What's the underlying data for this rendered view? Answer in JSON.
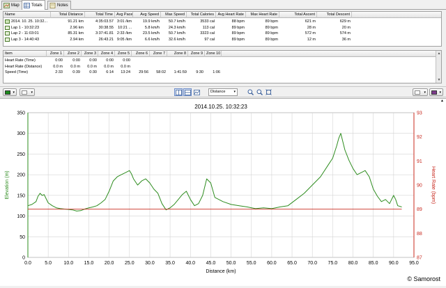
{
  "tabs": [
    {
      "label": "Map",
      "icon": "map-icon"
    },
    {
      "label": "Totals",
      "icon": "table-icon"
    },
    {
      "label": "Notes",
      "icon": "notes-icon"
    }
  ],
  "totals": {
    "headers": [
      "Name",
      "Total Distance",
      "Total Time",
      "Avg Pace",
      "Avg Speed",
      "Max Speed",
      "Total Calories",
      "Avg Heart Rate",
      "Max Heart Rate",
      "Total Ascent",
      "Total Descent"
    ],
    "rows": [
      [
        "2014. 10. 25. 10:32...",
        "91.21 km",
        "4:35:03.57",
        "3:01 /km",
        "19.9 km/h",
        "50.7 km/h",
        "3533 cal",
        "88 bpm",
        "89 bpm",
        "621 m",
        "629 m"
      ],
      [
        "Lap 1 - 10:32:23",
        "2.96 km",
        "30:38.55",
        "10:21 ...",
        "5.8 km/h",
        "24.3 km/h",
        "113 cal",
        "89 bpm",
        "89 bpm",
        "28 m",
        "20 m"
      ],
      [
        "Lap 2 - 11:03:01",
        "85.31 km",
        "3:37:41.81",
        "2:33 /km",
        "23.5 km/h",
        "50.7 km/h",
        "3323 cal",
        "89 bpm",
        "89 bpm",
        "572 m",
        "574 m"
      ],
      [
        "Lap 3 - 14:40:43",
        "2.94 km",
        "26:43.21",
        "9:05 /km",
        "6.6 km/h",
        "32.6 km/h",
        "97 cal",
        "89 bpm",
        "89 bpm",
        "12 m",
        "36 m"
      ]
    ]
  },
  "zones": {
    "headers": [
      "Item",
      "Zone 1",
      "Zone 2",
      "Zone 3",
      "Zone 4",
      "Zone 5",
      "Zone 6",
      "Zone 7",
      "Zone 8",
      "Zone 9",
      "Zone 10"
    ],
    "rows": [
      [
        "Heart Rate (Time)",
        "0:00",
        "0:00",
        "0:00",
        "0:00",
        "0:00",
        "",
        "",
        "",
        "",
        ""
      ],
      [
        "Heart Rate (Distance)",
        "0.0 m",
        "0.0 m",
        "0.0 m",
        "0.0 m",
        "0.0 m",
        "",
        "",
        "",
        "",
        ""
      ],
      [
        "Speed (Time)",
        "2:33",
        "0:39",
        "0:30",
        "6:14",
        "13:24",
        "29:56",
        "58:02",
        "1:41:59",
        "9:30",
        "1:06"
      ]
    ]
  },
  "toolbar": {
    "distance_combo": "Distance",
    "colors": {
      "left": "#1e8c1e",
      "right": "#7d3c8c",
      "elevation": "#2d8c1e",
      "heart": "#c8281e"
    }
  },
  "chart_data": {
    "type": "line",
    "title": "2014.10.25. 10:32:23",
    "xlabel": "Distance (km)",
    "ylabel": "Elevation (m)",
    "y2label": "Heart Rate (bpm)",
    "xlim": [
      0,
      95
    ],
    "ylim": [
      0,
      350
    ],
    "y2lim": [
      87,
      93
    ],
    "xticks": [
      "0.0",
      "5.0",
      "10.0",
      "15.0",
      "20.0",
      "25.0",
      "30.0",
      "35.0",
      "40.0",
      "45.0",
      "50.0",
      "55.0",
      "60.0",
      "65.0",
      "70.0",
      "75.0",
      "80.0",
      "85.0",
      "90.0",
      "95.0"
    ],
    "yticks": [
      "0",
      "50",
      "100",
      "150",
      "200",
      "250",
      "300",
      "350"
    ],
    "y2ticks": [
      "87",
      "88",
      "89",
      "90",
      "91",
      "92",
      "93"
    ],
    "grid": true,
    "series": [
      {
        "name": "Elevation",
        "axis": "left",
        "x": [
          0.0,
          1.0,
          2.0,
          2.5,
          3.0,
          3.5,
          4.0,
          4.5,
          5.0,
          6.0,
          7.0,
          8.0,
          9.0,
          10.0,
          11.0,
          12.0,
          13.0,
          14.0,
          15.0,
          16.0,
          17.0,
          18.0,
          19.0,
          20.0,
          21.0,
          22.0,
          23.0,
          24.0,
          25.0,
          25.5,
          26.0,
          27.0,
          28.0,
          29.0,
          30.0,
          31.0,
          32.0,
          33.0,
          34.0,
          35.0,
          36.0,
          37.0,
          38.0,
          39.0,
          40.0,
          41.0,
          42.0,
          43.0,
          44.0,
          45.0,
          46.0,
          47.0,
          48.0,
          50.0,
          52.0,
          54.0,
          56.0,
          58.0,
          60.0,
          62.0,
          64.0,
          66.0,
          68.0,
          70.0,
          72.0,
          74.0,
          75.0,
          76.0,
          76.5,
          77.0,
          78.0,
          79.0,
          80.0,
          81.0,
          82.0,
          83.0,
          84.0,
          85.0,
          86.0,
          87.0,
          88.0,
          89.0,
          90.0,
          90.5,
          91.0,
          92.0
        ],
        "y": [
          125,
          128,
          135,
          148,
          155,
          150,
          152,
          142,
          132,
          125,
          120,
          118,
          117,
          116,
          115,
          112,
          113,
          117,
          120,
          122,
          125,
          132,
          140,
          160,
          185,
          195,
          200,
          205,
          210,
          202,
          190,
          175,
          185,
          190,
          180,
          165,
          155,
          130,
          115,
          120,
          128,
          140,
          152,
          160,
          140,
          125,
          130,
          150,
          190,
          180,
          145,
          140,
          135,
          128,
          125,
          122,
          118,
          120,
          118,
          122,
          125,
          140,
          155,
          175,
          195,
          225,
          240,
          270,
          288,
          300,
          260,
          235,
          215,
          200,
          205,
          210,
          195,
          165,
          148,
          135,
          140,
          130,
          150,
          140,
          125,
          122
        ]
      },
      {
        "name": "Heart Rate",
        "axis": "right",
        "x": [
          0,
          92
        ],
        "y": [
          89,
          89
        ]
      }
    ]
  },
  "watermark": "© Samorost"
}
